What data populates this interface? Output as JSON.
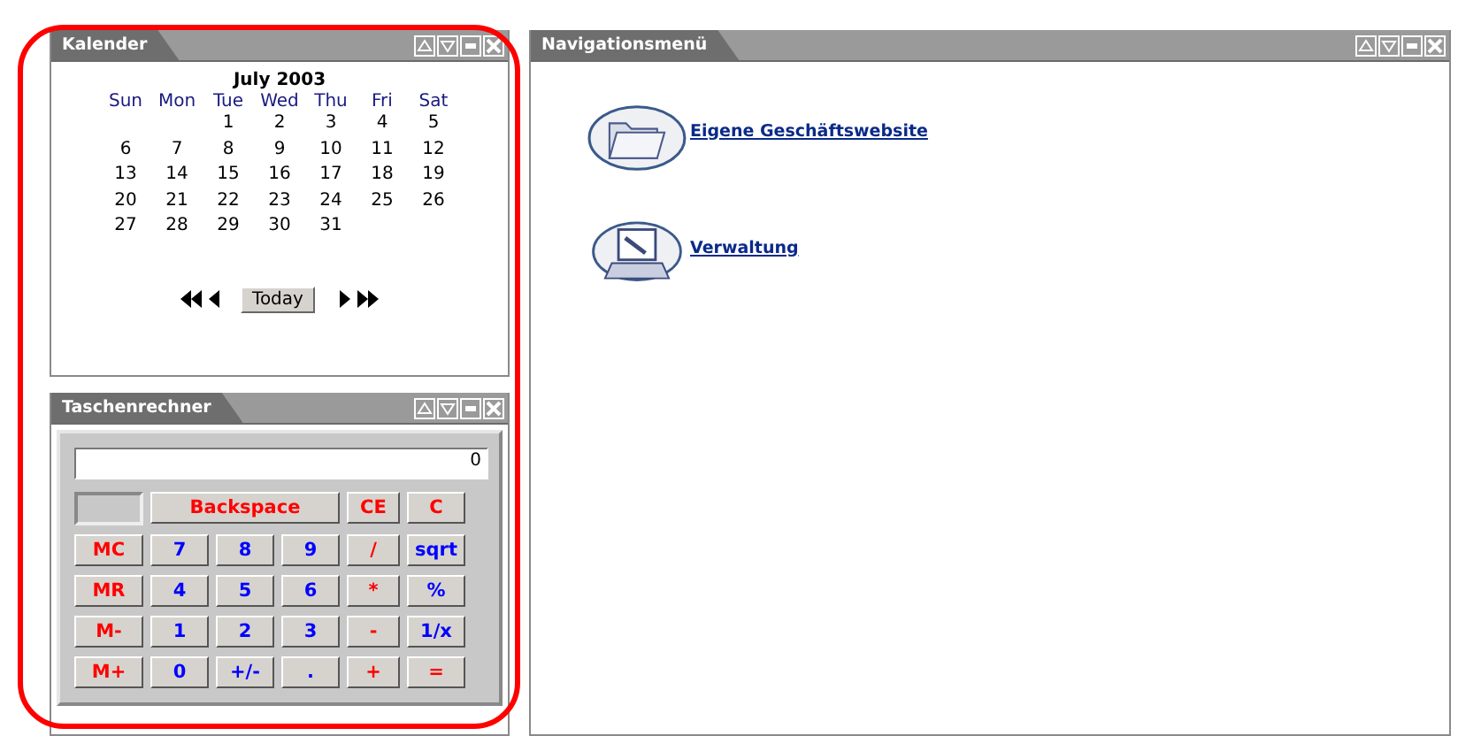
{
  "calendar": {
    "title": "Kalender",
    "month": "July 2003",
    "weekdays": [
      "Sun",
      "Mon",
      "Tue",
      "Wed",
      "Thu",
      "Fri",
      "Sat"
    ],
    "weeks": [
      {
        "kind": "first",
        "days": [
          "1",
          "2",
          "3",
          "4",
          "5"
        ]
      },
      {
        "kind": "full",
        "days": [
          "6",
          "7",
          "8",
          "9",
          "10",
          "11",
          "12"
        ]
      },
      {
        "kind": "full",
        "days": [
          "13",
          "14",
          "15",
          "16",
          "17",
          "18",
          "19"
        ]
      },
      {
        "kind": "full",
        "days": [
          "20",
          "21",
          "22",
          "23",
          "24",
          "25",
          "26"
        ]
      },
      {
        "kind": "last",
        "days": [
          "27",
          "28",
          "29",
          "30",
          "31"
        ]
      }
    ],
    "today_button": "Today"
  },
  "calculator": {
    "title": "Taschenrechner",
    "display": "0",
    "keys": [
      {
        "label": "Backspace",
        "color": "#ff0000"
      },
      {
        "label": "CE",
        "color": "#ff0000"
      },
      {
        "label": "C",
        "color": "#ff0000"
      },
      {
        "label": "MC",
        "color": "#ff0000"
      },
      {
        "label": "7",
        "color": "#0000ff"
      },
      {
        "label": "8",
        "color": "#0000ff"
      },
      {
        "label": "9",
        "color": "#0000ff"
      },
      {
        "label": "/",
        "color": "#ff0000"
      },
      {
        "label": "sqrt",
        "color": "#0000ff"
      },
      {
        "label": "MR",
        "color": "#ff0000"
      },
      {
        "label": "4",
        "color": "#0000ff"
      },
      {
        "label": "5",
        "color": "#0000ff"
      },
      {
        "label": "6",
        "color": "#0000ff"
      },
      {
        "label": "*",
        "color": "#ff0000"
      },
      {
        "label": "%",
        "color": "#0000ff"
      },
      {
        "label": "M-",
        "color": "#ff0000"
      },
      {
        "label": "1",
        "color": "#0000ff"
      },
      {
        "label": "2",
        "color": "#0000ff"
      },
      {
        "label": "3",
        "color": "#0000ff"
      },
      {
        "label": "-",
        "color": "#ff0000"
      },
      {
        "label": "1/x",
        "color": "#0000ff"
      },
      {
        "label": "M+",
        "color": "#ff0000"
      },
      {
        "label": "0",
        "color": "#0000ff"
      },
      {
        "label": "+/-",
        "color": "#0000ff"
      },
      {
        "label": ".",
        "color": "#0000ff"
      },
      {
        "label": "+",
        "color": "#ff0000"
      },
      {
        "label": "=",
        "color": "#ff0000"
      }
    ]
  },
  "navigation": {
    "title": "Navigationsmenü",
    "items": [
      {
        "label": "Eigene Geschäftswebsite",
        "kind": "folder"
      },
      {
        "label": "Verwaltung",
        "kind": "laptop"
      }
    ]
  }
}
